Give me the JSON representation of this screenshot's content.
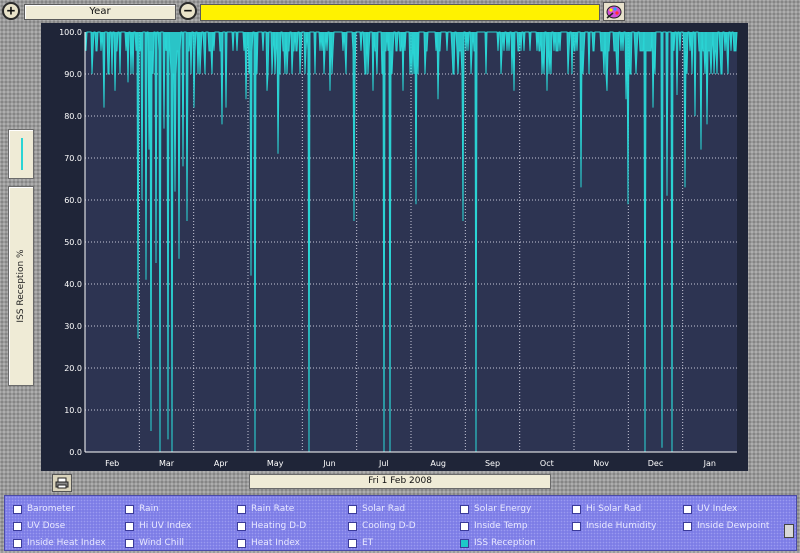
{
  "toolbar": {
    "zoom_in_symbol": "+",
    "period_label": "Year",
    "zoom_out_symbol": "−",
    "status_text": "",
    "status_color": "#fff200"
  },
  "legend": {
    "series_tab_label": "ISS Reception  %",
    "series_color": "#2ad4d4"
  },
  "date_field": "Fri 1 Feb 2008",
  "chart_data": {
    "type": "line",
    "title": "",
    "xlabel": "",
    "ylabel": "ISS Reception  %",
    "ylim": [
      0,
      100
    ],
    "yticks": [
      "0.0",
      "10.0",
      "20.0",
      "30.0",
      "40.0",
      "50.0",
      "60.0",
      "70.0",
      "80.0",
      "90.0",
      "100.0"
    ],
    "xticks": [
      "Feb",
      "Mar",
      "Apr",
      "May",
      "Jun",
      "Jul",
      "Aug",
      "Sep",
      "Oct",
      "Nov",
      "Dec",
      "Jan"
    ],
    "grid": true,
    "series": [
      {
        "color": "#2ad4d4",
        "baseline_range": [
          90,
          100
        ],
        "dips": [
          {
            "month": 0.35,
            "value": 82
          },
          {
            "month": 0.55,
            "value": 86
          },
          {
            "month": 0.8,
            "value": 88
          },
          {
            "month": 0.97,
            "value": 27
          },
          {
            "month": 1.05,
            "value": 60
          },
          {
            "month": 1.12,
            "value": 41
          },
          {
            "month": 1.17,
            "value": 72
          },
          {
            "month": 1.22,
            "value": 5
          },
          {
            "month": 1.3,
            "value": 45
          },
          {
            "month": 1.38,
            "value": 0
          },
          {
            "month": 1.45,
            "value": 77
          },
          {
            "month": 1.52,
            "value": 3
          },
          {
            "month": 1.6,
            "value": 0
          },
          {
            "month": 1.66,
            "value": 62
          },
          {
            "month": 1.73,
            "value": 46
          },
          {
            "month": 1.8,
            "value": 68
          },
          {
            "month": 1.87,
            "value": 55
          },
          {
            "month": 2.0,
            "value": 82
          },
          {
            "month": 2.52,
            "value": 78
          },
          {
            "month": 2.6,
            "value": 82
          },
          {
            "month": 2.96,
            "value": 84
          },
          {
            "month": 3.05,
            "value": 42
          },
          {
            "month": 3.12,
            "value": 0
          },
          {
            "month": 3.35,
            "value": 86
          },
          {
            "month": 3.55,
            "value": 71
          },
          {
            "month": 4.13,
            "value": 0
          },
          {
            "month": 4.5,
            "value": 86
          },
          {
            "month": 4.95,
            "value": 55
          },
          {
            "month": 5.3,
            "value": 86
          },
          {
            "month": 5.5,
            "value": 0
          },
          {
            "month": 5.62,
            "value": 0
          },
          {
            "month": 5.85,
            "value": 86
          },
          {
            "month": 6.1,
            "value": 59
          },
          {
            "month": 6.5,
            "value": 84
          },
          {
            "month": 6.95,
            "value": 55
          },
          {
            "month": 7.2,
            "value": 0
          },
          {
            "month": 7.9,
            "value": 86
          },
          {
            "month": 8.5,
            "value": 86
          },
          {
            "month": 9.12,
            "value": 63
          },
          {
            "month": 9.6,
            "value": 86
          },
          {
            "month": 9.95,
            "value": 84
          },
          {
            "month": 10.0,
            "value": 59
          },
          {
            "month": 10.3,
            "value": 0
          },
          {
            "month": 10.45,
            "value": 82
          },
          {
            "month": 10.62,
            "value": 1
          },
          {
            "month": 10.72,
            "value": 61
          },
          {
            "month": 10.8,
            "value": 0
          },
          {
            "month": 10.9,
            "value": 85
          },
          {
            "month": 11.05,
            "value": 63
          },
          {
            "month": 11.22,
            "value": 80
          },
          {
            "month": 11.33,
            "value": 72
          },
          {
            "month": 11.45,
            "value": 78
          }
        ]
      }
    ]
  },
  "sensors": [
    {
      "label": "Barometer",
      "checked": false
    },
    {
      "label": "Rain",
      "checked": false
    },
    {
      "label": "Rain Rate",
      "checked": false
    },
    {
      "label": "Solar Rad",
      "checked": false
    },
    {
      "label": "Solar Energy",
      "checked": false
    },
    {
      "label": "Hi Solar Rad",
      "checked": false
    },
    {
      "label": "UV Index",
      "checked": false
    },
    {
      "label": "UV Dose",
      "checked": false
    },
    {
      "label": "Hi UV Index",
      "checked": false
    },
    {
      "label": "Heating D-D",
      "checked": false
    },
    {
      "label": "Cooling D-D",
      "checked": false
    },
    {
      "label": "Inside Temp",
      "checked": false
    },
    {
      "label": "Inside Humidity",
      "checked": false
    },
    {
      "label": "Inside Dewpoint",
      "checked": false
    },
    {
      "label": "Inside Heat Index",
      "checked": false
    },
    {
      "label": "Wind Chill",
      "checked": false
    },
    {
      "label": "Heat Index",
      "checked": false
    },
    {
      "label": "ET",
      "checked": false
    },
    {
      "label": "ISS Reception",
      "checked": true
    }
  ]
}
